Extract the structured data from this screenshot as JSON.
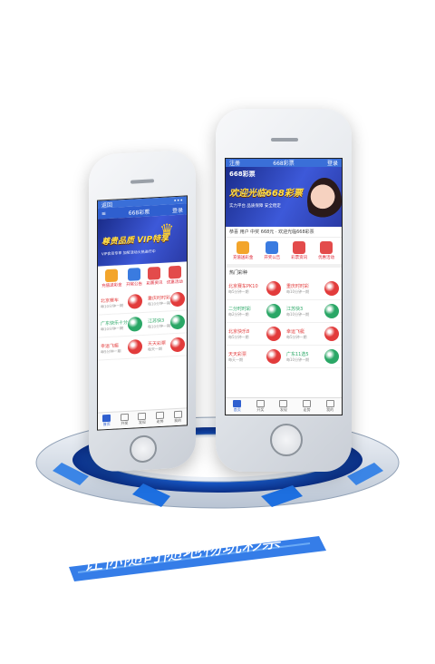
{
  "colors": {
    "brand": "#2f5fcf",
    "accent": "#ffe04a",
    "red": "#e23b3b",
    "green": "#2aa766"
  },
  "back_phone": {
    "status_left": "返回",
    "nav_title": "668彩票",
    "nav_right": "登录",
    "banner_title": "尊贵品质 VIP特享",
    "banner_sub": "VIP会员专享 加奖活动火热进行中",
    "icons": [
      {
        "label": "充值送彩金",
        "color": "#f3a52b"
      },
      {
        "label": "开奖公告",
        "color": "#3a7be0"
      },
      {
        "label": "彩票资讯",
        "color": "#e34b4b"
      },
      {
        "label": "优惠活动",
        "color": "#e34b4b"
      }
    ],
    "games": [
      {
        "name": "北京赛车",
        "sub": "每10分钟一期",
        "color": "#e23b3b"
      },
      {
        "name": "重庆时时彩",
        "sub": "每10分钟一期",
        "color": "#e23b3b"
      },
      {
        "name": "广东快乐十分",
        "sub": "每10分钟一期",
        "color": "#2aa766"
      },
      {
        "name": "江苏快3",
        "sub": "每10分钟一期",
        "color": "#2aa766"
      },
      {
        "name": "幸运飞艇",
        "sub": "每5分钟一期",
        "color": "#e23b3b"
      },
      {
        "name": "天天彩票",
        "sub": "每天一期",
        "color": "#e23b3b"
      }
    ],
    "tabs": [
      "首页",
      "开奖",
      "发现",
      "走势",
      "我的"
    ]
  },
  "front_phone": {
    "status_left": "注册",
    "nav_title": "668彩票",
    "nav_right": "登录",
    "logo": "668彩票",
    "banner_title": "欢迎光临668彩票",
    "banner_sub": "实力平台 品质保障 安全稳定",
    "notice": "恭喜 用户 中奖 668元 · 欢迎光临668彩票",
    "icons": [
      {
        "label": "充值送彩金",
        "color": "#f3a52b"
      },
      {
        "label": "开奖公告",
        "color": "#3a7be0"
      },
      {
        "label": "彩票资讯",
        "color": "#e34b4b"
      },
      {
        "label": "优惠活动",
        "color": "#e34b4b"
      }
    ],
    "section": "热门彩种",
    "games": [
      {
        "name": "北京赛车PK10",
        "sub": "每5分钟一期",
        "color": "#e23b3b"
      },
      {
        "name": "重庆时时彩",
        "sub": "每10分钟一期",
        "color": "#e23b3b"
      },
      {
        "name": "二分时时彩",
        "sub": "每2分钟一期",
        "color": "#2aa766"
      },
      {
        "name": "江苏快3",
        "sub": "每10分钟一期",
        "color": "#2aa766"
      },
      {
        "name": "北京快乐8",
        "sub": "每5分钟一期",
        "color": "#e23b3b"
      },
      {
        "name": "幸运飞艇",
        "sub": "每5分钟一期",
        "color": "#e23b3b"
      },
      {
        "name": "天天彩票",
        "sub": "每天一期",
        "color": "#e23b3b"
      },
      {
        "name": "广东11选5",
        "sub": "每10分钟一期",
        "color": "#2aa766"
      }
    ],
    "tabs": [
      "首页",
      "开奖",
      "发现",
      "走势",
      "我的"
    ]
  },
  "slogan": "让你随时随地畅玩彩票"
}
